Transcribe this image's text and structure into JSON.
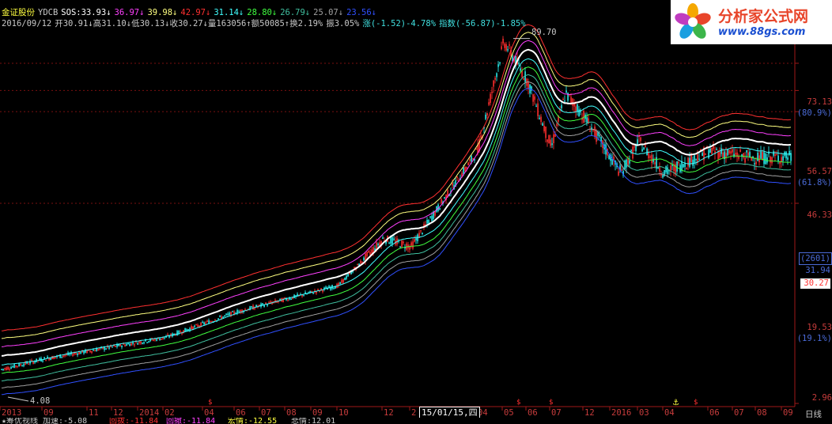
{
  "colors": {
    "up": "#e02828",
    "down": "#22d0d0",
    "grid": "#7a1010",
    "axis": "#a01818",
    "header_text": "#c8c8c8",
    "axis_label": "#c83c3c",
    "pct_label": "#4b6bd8"
  },
  "header": {
    "line1": [
      {
        "text": "金证股份",
        "color": "#ffff40"
      },
      {
        "text": "YDCB",
        "color": "#c8c8c8"
      },
      {
        "text": "SOS:33.93↓",
        "color": "#ffffff"
      },
      {
        "text": "36.97↓",
        "color": "#ff40ff"
      },
      {
        "text": "39.98↓",
        "color": "#ffff80"
      },
      {
        "text": "42.97↓",
        "color": "#ff3030"
      },
      {
        "text": "31.14↓",
        "color": "#40ffff"
      },
      {
        "text": "28.80↓",
        "color": "#40ff40"
      },
      {
        "text": "26.79↓",
        "color": "#40c0a0"
      },
      {
        "text": "25.07↓",
        "color": "#a0a0a0"
      },
      {
        "text": "23.56↓",
        "color": "#3050ff"
      }
    ],
    "line2": [
      {
        "text": "2016/09/12",
        "color": "#c8c8c8"
      },
      {
        "text": "开30.91↓高31.10↓低30.13↓收30.27↓量163056↑额50085↑换2.19%",
        "color": "#c8c8c8"
      },
      {
        "text": "振3.05%",
        "color": "#c8c8c8"
      },
      {
        "text": "涨(-1.52)-4.78%",
        "color": "#40e0e0"
      },
      {
        "text": "指数(-56.87)-1.85%",
        "color": "#40e0e0"
      }
    ]
  },
  "price_axis": [
    {
      "value": "73.13",
      "pct": "(80.9%)"
    },
    {
      "value": "56.57",
      "pct": "(61.8%)"
    },
    {
      "value": "46.33",
      "pct": ""
    },
    {
      "value": "19.53",
      "pct": "(19.1%)"
    },
    {
      "value": "2.96",
      "pct": ""
    }
  ],
  "right_markers": {
    "box": "(2601)",
    "level": "31.94",
    "last": "30.27"
  },
  "peak_label": "89.70",
  "low_label": "4.08",
  "time_axis": {
    "labels": [
      "2013",
      "09",
      "11",
      "12",
      "2014",
      "02",
      "04",
      "06",
      "07",
      "08",
      "09",
      "10",
      "12",
      "2",
      "04",
      "05",
      "06",
      "07",
      "12",
      "2016",
      "03",
      "04",
      "06",
      "07",
      "08",
      "09"
    ],
    "date_box": "15/01/15,四",
    "period": "日线"
  },
  "bottom_bar": [
    {
      "text": "★筹优视线 加速:-5.08",
      "color": "#c8c8c8"
    },
    {
      "text": "回拔:-11.84",
      "color": "#ff3030"
    },
    {
      "text": "回撤:-11.84",
      "color": "#ff40ff"
    },
    {
      "text": "宏情:-12.55",
      "color": "#ffff40"
    },
    {
      "text": "悲情:12.01",
      "color": "#c8c8c8"
    }
  ],
  "logo": {
    "name": "分析家公式网",
    "url": "www.88gs.com"
  },
  "chart_data": {
    "type": "line",
    "title": "",
    "xlabel": "",
    "ylabel": "",
    "y_scale": "log",
    "ylim": [
      2.96,
      100
    ],
    "x_range": [
      "2013",
      "2016/09/12"
    ],
    "grid": true,
    "legend": "none",
    "price_close_keypoints": [
      {
        "x": "2013",
        "y": 4.08
      },
      {
        "x": "2013-09",
        "y": 4.5
      },
      {
        "x": "2014-02",
        "y": 5.5
      },
      {
        "x": "2014-06",
        "y": 7.0
      },
      {
        "x": "2014-10",
        "y": 9.0
      },
      {
        "x": "2014-12",
        "y": 14.0
      },
      {
        "x": "2015-01",
        "y": 13.0
      },
      {
        "x": "2015-04",
        "y": 32.0
      },
      {
        "x": "2015-05",
        "y": 89.7
      },
      {
        "x": "2015-06",
        "y": 62.0
      },
      {
        "x": "2015-07",
        "y": 33.0
      },
      {
        "x": "2015-08",
        "y": 55.0
      },
      {
        "x": "2015-12",
        "y": 44.0
      },
      {
        "x": "2016-02",
        "y": 26.0
      },
      {
        "x": "2016-03",
        "y": 35.0
      },
      {
        "x": "2016-04",
        "y": 26.0
      },
      {
        "x": "2016-06",
        "y": 32.0
      },
      {
        "x": "2016-08",
        "y": 30.0
      },
      {
        "x": "2016-09",
        "y": 30.27
      }
    ],
    "series": [
      {
        "name": "SOS",
        "color": "#ffffff",
        "last": 33.93
      },
      {
        "name": "",
        "color": "#ff40ff",
        "last": 36.97
      },
      {
        "name": "",
        "color": "#ffff80",
        "last": 39.98
      },
      {
        "name": "",
        "color": "#ff3030",
        "last": 42.97
      },
      {
        "name": "",
        "color": "#40ffff",
        "last": 31.14
      },
      {
        "name": "",
        "color": "#40ff40",
        "last": 28.8
      },
      {
        "name": "",
        "color": "#40c0a0",
        "last": 26.79
      },
      {
        "name": "",
        "color": "#a0a0a0",
        "last": 25.07
      },
      {
        "name": "",
        "color": "#3050ff",
        "last": 23.56
      }
    ],
    "last_close": 30.27
  }
}
